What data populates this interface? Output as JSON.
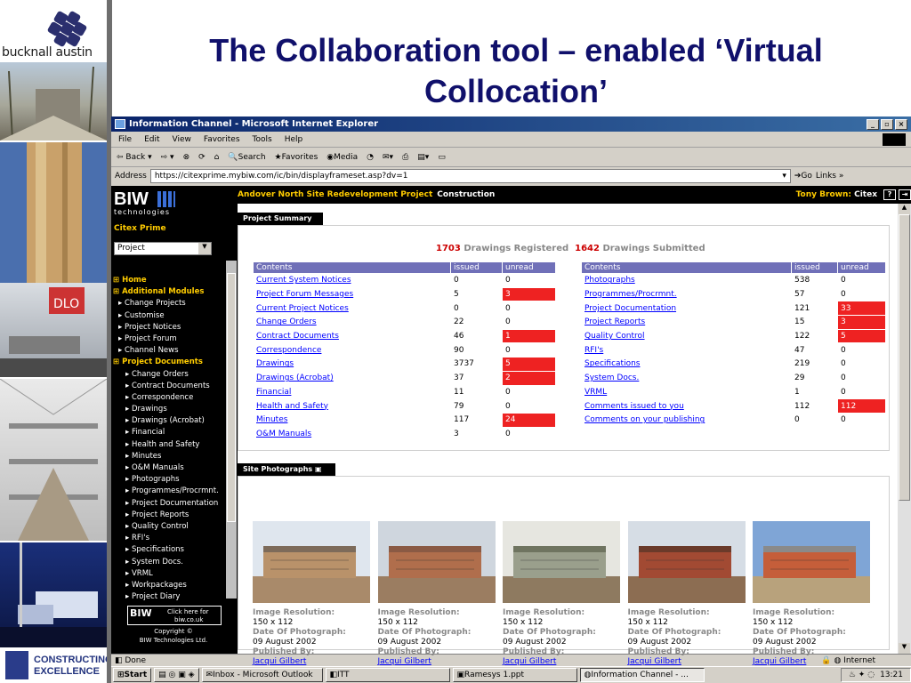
{
  "slide": {
    "title_line1": "The Collaboration tool – enabled ‘Virtual",
    "title_line2": "Collocation’",
    "logo_text": "bucknall austin",
    "ce_logo_line1": "CONSTRUCTING",
    "ce_logo_line2": "EXCELLENCE"
  },
  "browser": {
    "window_title": "Information Channel - Microsoft Internet Explorer",
    "menu": [
      "File",
      "Edit",
      "View",
      "Favorites",
      "Tools",
      "Help"
    ],
    "toolbar": {
      "back": "Back",
      "search": "Search",
      "favorites": "Favorites",
      "media": "Media"
    },
    "address_label": "Address",
    "address_value": "https://citexprime.mybiw.com/ic/bin/displayframeset.asp?dv=1",
    "go_label": "Go",
    "links_label": "Links",
    "status_text": "Done",
    "status_zone": "Internet"
  },
  "sidebar": {
    "logo": "BIW",
    "logo_sub": "technologies",
    "site_name": "Citex Prime",
    "select_value": "Project",
    "nav": [
      {
        "label": "Home",
        "level": "top"
      },
      {
        "label": "Additional Modules",
        "level": "top"
      },
      {
        "label": "Change Projects",
        "level": "l1"
      },
      {
        "label": "Customise",
        "level": "l1"
      },
      {
        "label": "Project Notices",
        "level": "l1"
      },
      {
        "label": "Project Forum",
        "level": "l1"
      },
      {
        "label": "Channel News",
        "level": "l1"
      },
      {
        "label": "Project Documents",
        "level": "top"
      },
      {
        "label": "Change Orders",
        "level": "l2"
      },
      {
        "label": "Contract Documents",
        "level": "l2"
      },
      {
        "label": "Correspondence",
        "level": "l2"
      },
      {
        "label": "Drawings",
        "level": "l2"
      },
      {
        "label": "Drawings (Acrobat)",
        "level": "l2"
      },
      {
        "label": "Financial",
        "level": "l2"
      },
      {
        "label": "Health and Safety",
        "level": "l2"
      },
      {
        "label": "Minutes",
        "level": "l2"
      },
      {
        "label": "O&M Manuals",
        "level": "l2"
      },
      {
        "label": "Photographs",
        "level": "l2"
      },
      {
        "label": "Programmes/Procrmnt.",
        "level": "l2"
      },
      {
        "label": "Project Documentation",
        "level": "l2"
      },
      {
        "label": "Project Reports",
        "level": "l2"
      },
      {
        "label": "Quality Control",
        "level": "l2"
      },
      {
        "label": "RFI's",
        "level": "l2"
      },
      {
        "label": "Specifications",
        "level": "l2"
      },
      {
        "label": "System Docs.",
        "level": "l2"
      },
      {
        "label": "VRML",
        "level": "l2"
      },
      {
        "label": "Workpackages",
        "level": "l2"
      },
      {
        "label": "Project Diary",
        "level": "l2"
      }
    ],
    "badge_line1": "Click here for",
    "badge_line2": "biw.co.uk",
    "copyright_line1": "Copyright ©",
    "copyright_line2": "BIW Technologies Ltd."
  },
  "topbar": {
    "project": "Andover North Site Redevelopment Project",
    "phase": "Construction",
    "user": "Tony Brown:",
    "company": "Citex"
  },
  "summary": {
    "header": "Project Summary",
    "registered_count": "1703",
    "registered_label": "Drawings Registered",
    "submitted_count": "1642",
    "submitted_label": "Drawings Submitted",
    "columns": [
      "Contents",
      "issued",
      "unread"
    ],
    "left_rows": [
      {
        "name": "Current System Notices",
        "issued": "0",
        "unread": "0",
        "red": false
      },
      {
        "name": "Project Forum Messages",
        "issued": "5",
        "unread": "3",
        "red": true
      },
      {
        "name": "Current Project Notices",
        "issued": "0",
        "unread": "0",
        "red": false
      },
      {
        "name": "Change Orders",
        "issued": "22",
        "unread": "0",
        "red": false
      },
      {
        "name": "Contract Documents",
        "issued": "46",
        "unread": "1",
        "red": true
      },
      {
        "name": "Correspondence",
        "issued": "90",
        "unread": "0",
        "red": false
      },
      {
        "name": "Drawings",
        "issued": "3737",
        "unread": "5",
        "red": true
      },
      {
        "name": "Drawings (Acrobat)",
        "issued": "37",
        "unread": "2",
        "red": true
      },
      {
        "name": "Financial",
        "issued": "11",
        "unread": "0",
        "red": false
      },
      {
        "name": "Health and Safety",
        "issued": "79",
        "unread": "0",
        "red": false
      },
      {
        "name": "Minutes",
        "issued": "117",
        "unread": "24",
        "red": true
      },
      {
        "name": "O&M Manuals",
        "issued": "3",
        "unread": "0",
        "red": false
      }
    ],
    "right_rows": [
      {
        "name": "Photographs",
        "issued": "538",
        "unread": "0",
        "red": false
      },
      {
        "name": "Programmes/Procrmnt.",
        "issued": "57",
        "unread": "0",
        "red": false
      },
      {
        "name": "Project Documentation",
        "issued": "121",
        "unread": "33",
        "red": true
      },
      {
        "name": "Project Reports",
        "issued": "15",
        "unread": "3",
        "red": true
      },
      {
        "name": "Quality Control",
        "issued": "122",
        "unread": "5",
        "red": true
      },
      {
        "name": "RFI's",
        "issued": "47",
        "unread": "0",
        "red": false
      },
      {
        "name": "Specifications",
        "issued": "219",
        "unread": "0",
        "red": false
      },
      {
        "name": "System Docs.",
        "issued": "29",
        "unread": "0",
        "red": false
      },
      {
        "name": "VRML",
        "issued": "1",
        "unread": "0",
        "red": false
      },
      {
        "name": "Comments issued to you",
        "issued": "112",
        "unread": "112",
        "red": true
      },
      {
        "name": "Comments on your publishing",
        "issued": "0",
        "unread": "0",
        "red": false
      }
    ]
  },
  "photos": {
    "header": "Site Photographs",
    "items": [
      {
        "res_label": "Image Resolution:",
        "res": "150 x 112",
        "date_label": "Date Of Photograph:",
        "date": "09 August 2002",
        "pub_label": "Published By:",
        "pub": "Jacqui Gilbert"
      },
      {
        "res_label": "Image Resolution:",
        "res": "150 x 112",
        "date_label": "Date Of Photograph:",
        "date": "09 August 2002",
        "pub_label": "Published By:",
        "pub": "Jacqui Gilbert"
      },
      {
        "res_label": "Image Resolution:",
        "res": "150 x 112",
        "date_label": "Date Of Photograph:",
        "date": "09 August 2002",
        "pub_label": "Published By:",
        "pub": "Jacqui Gilbert"
      },
      {
        "res_label": "Image Resolution:",
        "res": "150 x 112",
        "date_label": "Date Of Photograph:",
        "date": "09 August 2002",
        "pub_label": "Published By:",
        "pub": "Jacqui Gilbert"
      },
      {
        "res_label": "Image Resolution:",
        "res": "150 x 112",
        "date_label": "Date Of Photograph:",
        "date": "09 August 2002",
        "pub_label": "Published By:",
        "pub": "Jacqui Gilbert"
      }
    ]
  },
  "taskbar": {
    "start": "Start",
    "items": [
      "Inbox - Microsoft Outlook",
      "ITT",
      "Ramesys 1.ppt",
      "Information Channel - ..."
    ],
    "clock": "13:21"
  },
  "colors": {
    "slide_title": "#10106b",
    "table_header": "#7070b8",
    "unread_alert": "#ee2222",
    "nav_highlight": "#ffcc00"
  }
}
